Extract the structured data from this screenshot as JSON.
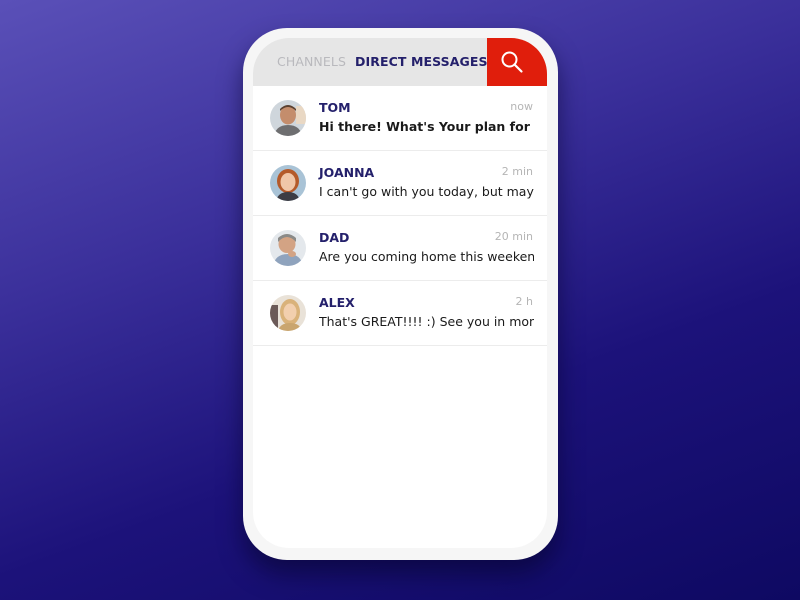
{
  "tabs": [
    {
      "label": "CHANNELS",
      "active": false
    },
    {
      "label": "DIRECT MESSAGES",
      "active": true
    }
  ],
  "search": {
    "icon": "search-icon"
  },
  "colors": {
    "accent": "#e01e0c",
    "name": "#24206b",
    "inactive_tab": "#b9b9bd",
    "bg_top": "#5a50b8",
    "bg_bottom": "#0e0962"
  },
  "conversations": [
    {
      "name": "TOM",
      "time": "now",
      "message": "Hi there! What's Your plan for a",
      "unread": true,
      "avatar": "avatar-tom"
    },
    {
      "name": "JOANNA",
      "time": "2 min",
      "message": "I can't go with you today, but maybe",
      "unread": false,
      "avatar": "avatar-joanna"
    },
    {
      "name": "DAD",
      "time": "20 min",
      "message": "Are you coming home this weekend?",
      "unread": false,
      "avatar": "avatar-dad"
    },
    {
      "name": "ALEX",
      "time": "2 h",
      "message": "That's GREAT!!!! :) See you in monday!",
      "unread": false,
      "avatar": "avatar-alex"
    }
  ]
}
